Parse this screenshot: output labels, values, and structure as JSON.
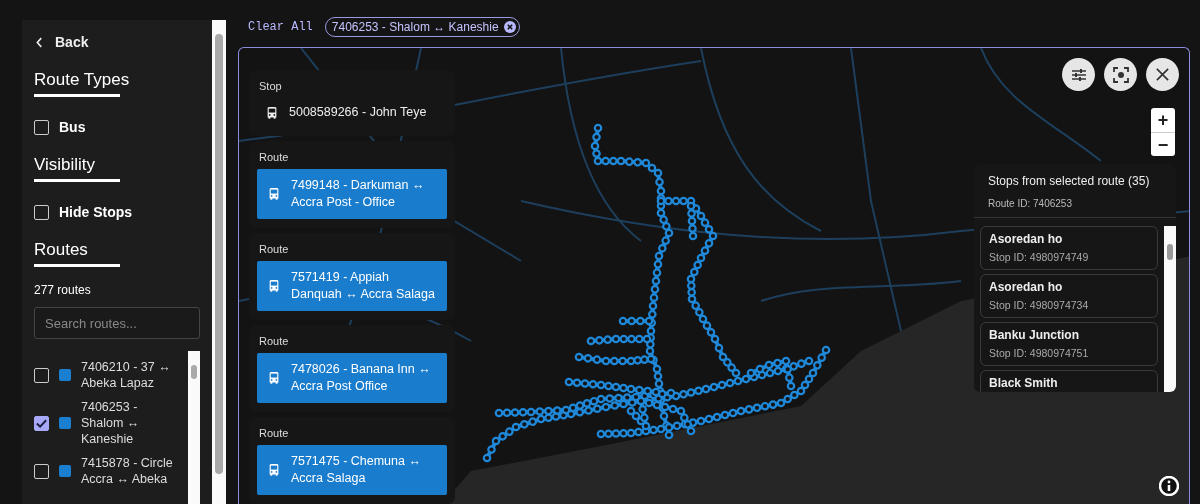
{
  "sidebar": {
    "back": "Back",
    "route_types": {
      "title": "Route Types",
      "options": [
        {
          "label": "Bus",
          "checked": false
        }
      ]
    },
    "visibility": {
      "title": "Visibility",
      "options": [
        {
          "label": "Hide Stops",
          "checked": false
        }
      ]
    },
    "routes": {
      "title": "Routes",
      "count": "277 routes",
      "search": {
        "placeholder": "Search routes..."
      },
      "items": [
        {
          "label": "7406210 - 37 ↔ Abeka Lapaz",
          "checked": false,
          "color": "#1b7fd1"
        },
        {
          "label": "7406253 - Shalom ↔ Kaneshie",
          "checked": true,
          "color": "#1b7fd1"
        },
        {
          "label": "7415878 - Circle Accra ↔ Abeka",
          "checked": false,
          "color": "#1b7fd1"
        }
      ]
    }
  },
  "filters": {
    "clear": "Clear All",
    "chips": [
      {
        "label": "7406253 - Shalom ↔ Kaneshie"
      }
    ]
  },
  "map": {
    "cards": [
      {
        "kind": "stop",
        "heading": "Stop",
        "label": "5008589266 - John Teye"
      },
      {
        "kind": "route",
        "heading": "Route",
        "label": "7499148 - Darkuman ↔ Accra Post - Office"
      },
      {
        "kind": "route",
        "heading": "Route",
        "label": "7571419 - Appiah Danquah ↔ Accra Salaga"
      },
      {
        "kind": "route",
        "heading": "Route",
        "label": "7478026 - Banana Inn ↔ Accra Post Office"
      },
      {
        "kind": "route",
        "heading": "Route",
        "label": "7571475 - Chemuna ↔ Accra Salaga"
      }
    ],
    "zoom": {
      "in": "+",
      "out": "−"
    },
    "stops_panel": {
      "title": "Stops from selected route (35)",
      "subtitle": "Route ID: 7406253",
      "items": [
        {
          "name": "Asoredan ho",
          "stop_id": "Stop ID: 4980974749"
        },
        {
          "name": "Asoredan ho",
          "stop_id": "Stop ID: 4980974734"
        },
        {
          "name": "Banku Junction",
          "stop_id": "Stop ID: 4980974751"
        },
        {
          "name": "Black Smith"
        }
      ]
    }
  }
}
